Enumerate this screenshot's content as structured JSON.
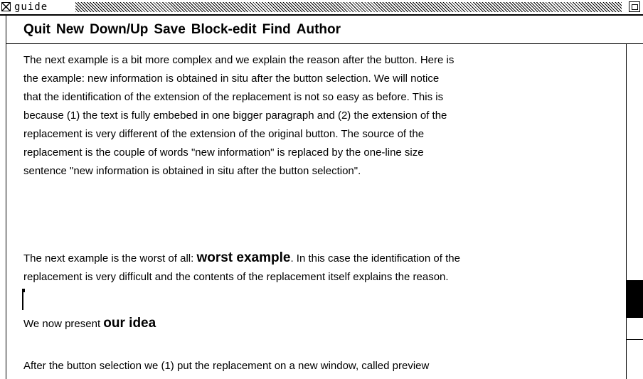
{
  "window": {
    "title": "guide"
  },
  "menu": {
    "items": [
      "Quit",
      "New",
      "Down/Up",
      "Save",
      "Block-edit",
      "Find",
      "Author"
    ]
  },
  "content": {
    "p1_lines": [
      "The next example is a bit more complex and we explain the reason after the button. Here is",
      "the example: new information is obtained  in situ after the button selection. We will notice",
      "that the identification of the extension of the replacement is not so easy as before. This is",
      "because (1) the text is fully embebed in one bigger paragraph and (2) the extension of the",
      "replacement is very different of the extension of the original button.   The source of the",
      "replacement is the couple of words \"new information\" is replaced by the one-line size",
      "sentence \"new information is obtained  in situ after the button selection\"."
    ],
    "p2_line1_before": "The next example is the worst of all:  ",
    "p2_button": "worst example",
    "p2_line1_after": ".  In this case the identification of the",
    "p2_line2": "replacement is very difficult and the contents of the replacement  itself explains the reason.",
    "p3_before": "We now present  ",
    "p3_button": "our idea",
    "p4_line1": "After the button selection we  (1)  put the replacement on a new window, called preview"
  },
  "scrollbar": {
    "thumb_start": 0.7049,
    "thumb_end": 0.8174
  },
  "colors": {
    "background": "#ffffff",
    "foreground": "#000000"
  }
}
